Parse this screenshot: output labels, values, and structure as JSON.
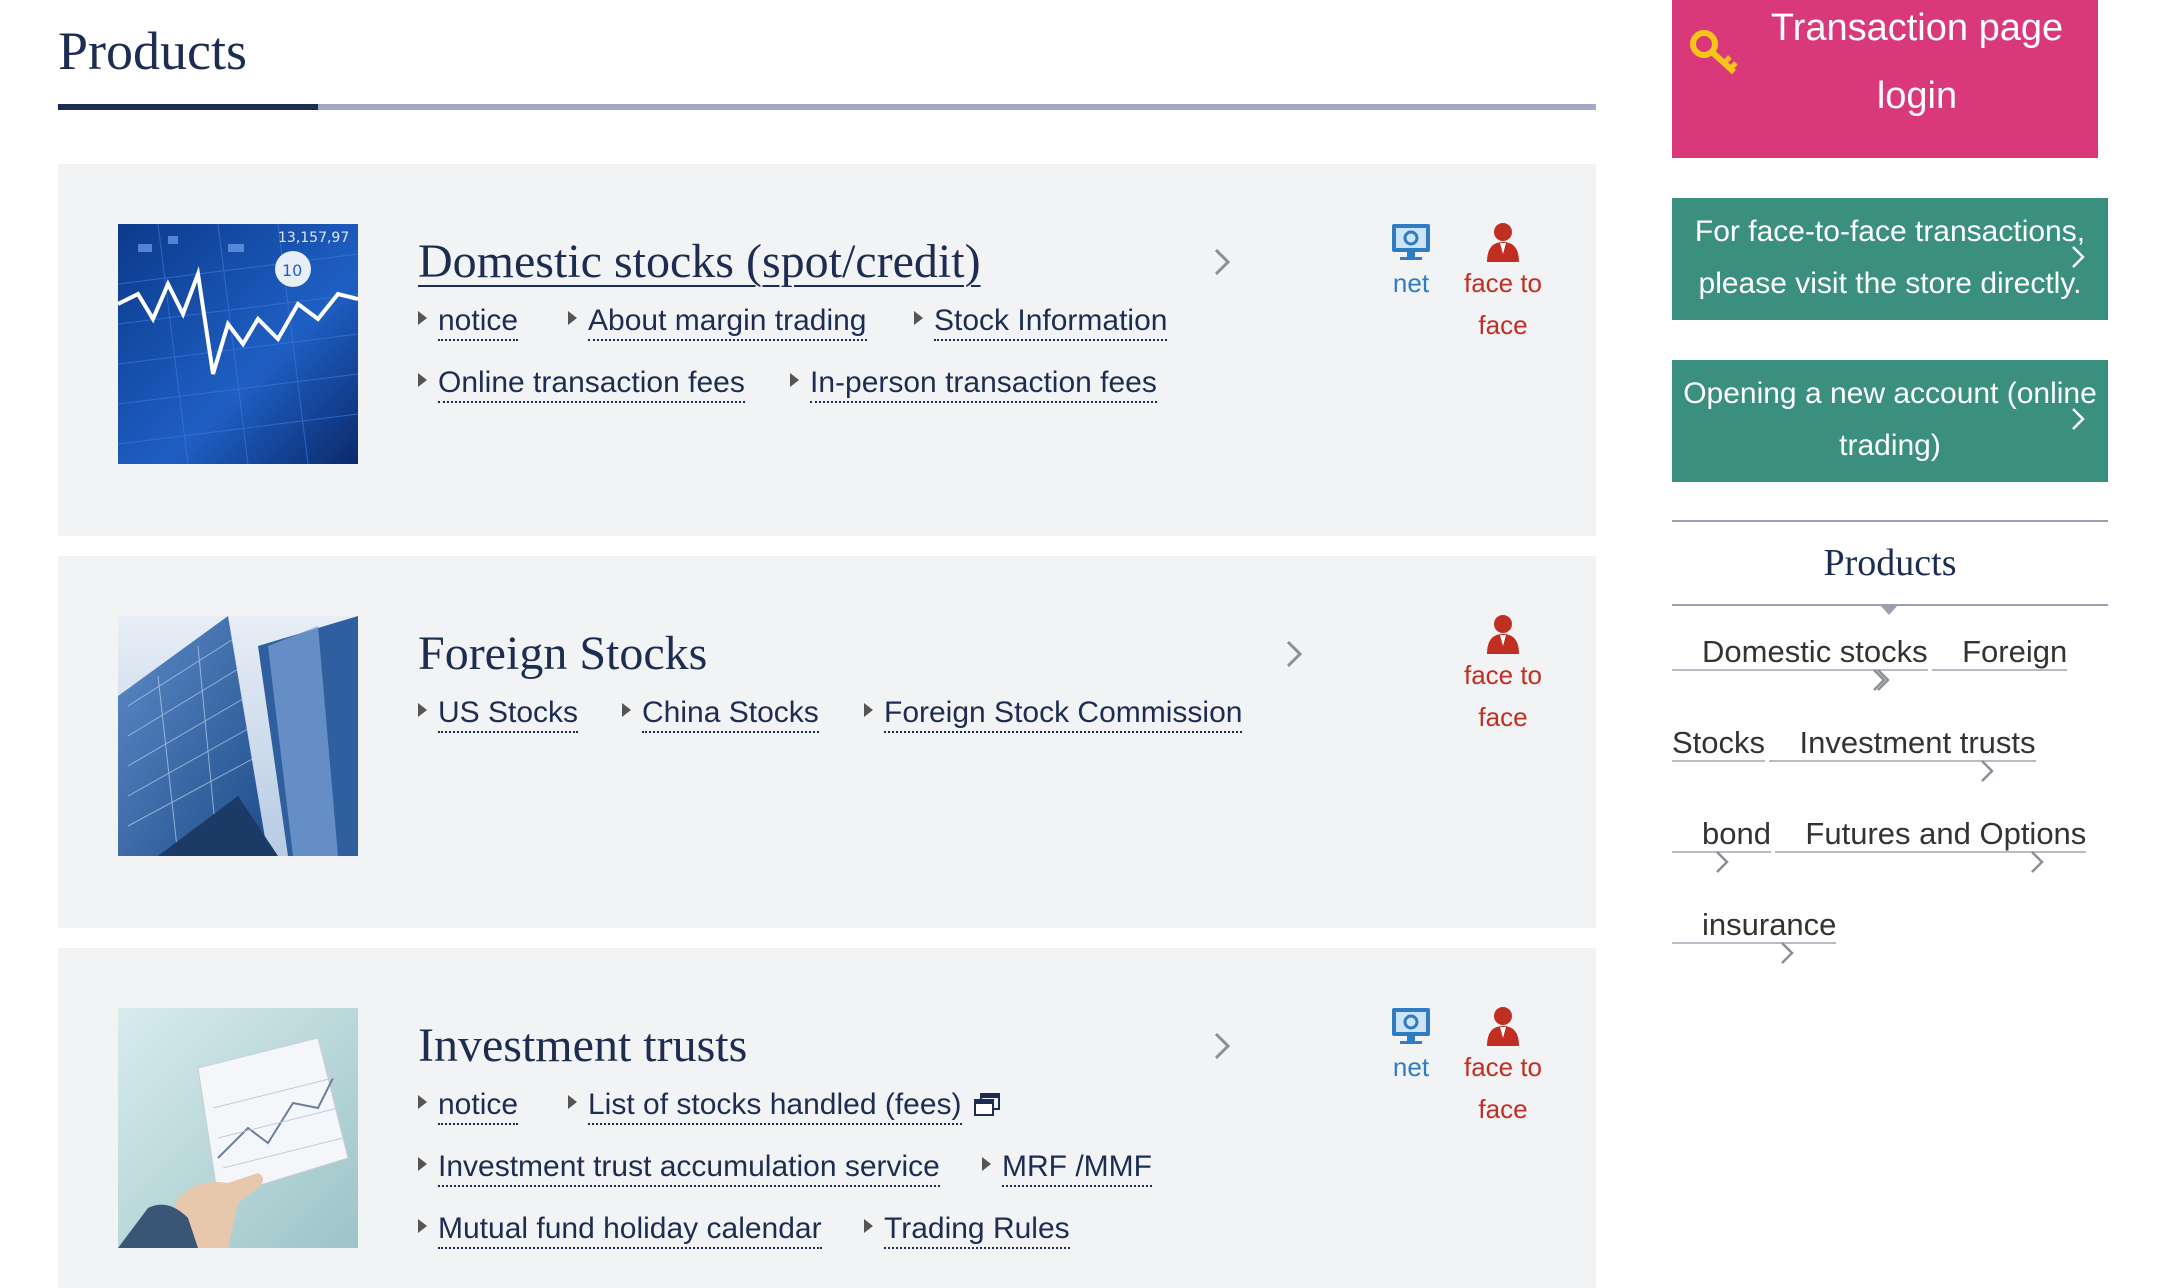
{
  "main": {
    "title": "Products",
    "cards": [
      {
        "title": "Domestic stocks (spot/credit)",
        "channels": [
          "net",
          "face to face"
        ],
        "links": [
          [
            "notice",
            "About margin trading",
            "Stock Information"
          ],
          [
            "Online transaction fees",
            "In-person transaction fees"
          ]
        ]
      },
      {
        "title": "Foreign Stocks",
        "channels": [
          "face to face"
        ],
        "links": [
          [
            "US Stocks",
            "China Stocks",
            "Foreign Stock Commission"
          ]
        ]
      },
      {
        "title": "Investment trusts",
        "channels": [
          "net",
          "face to face"
        ],
        "links": [
          [
            "notice",
            "List of stocks handled (fees)"
          ],
          [
            "Investment trust accumulation service",
            "MRF /MMF"
          ],
          [
            "Mutual fund holiday calendar",
            "Trading Rules"
          ]
        ]
      }
    ],
    "channel_labels": {
      "net": "net",
      "face_line1": "face to",
      "face_line2": "face"
    }
  },
  "sidebar": {
    "login": {
      "line1": "Transaction page",
      "line2": "login"
    },
    "face_to_face": {
      "line1": "For face-to-face transactions,",
      "line2": "please visit the store directly."
    },
    "new_account": {
      "line1": "Opening a new account (online",
      "line2": "trading)"
    },
    "products_heading": "Products",
    "products": [
      "Domestic stocks",
      "Foreign Stocks",
      "Investment trusts",
      "bond",
      "Futures and Options",
      "insurance"
    ]
  },
  "colors": {
    "navy": "#1d2d52",
    "login_pink": "#d9397a",
    "teal": "#3b8f7e",
    "net_blue": "#2e7cc4",
    "face_red": "#c12f23",
    "card_bg": "#f2f3f5"
  },
  "icons": {
    "net": "monitor-icon",
    "face": "person-icon",
    "login": "key-icon",
    "external": "external-window-icon",
    "bullet": "triangle-bullet-icon",
    "chevron": "chevron-right-icon"
  }
}
